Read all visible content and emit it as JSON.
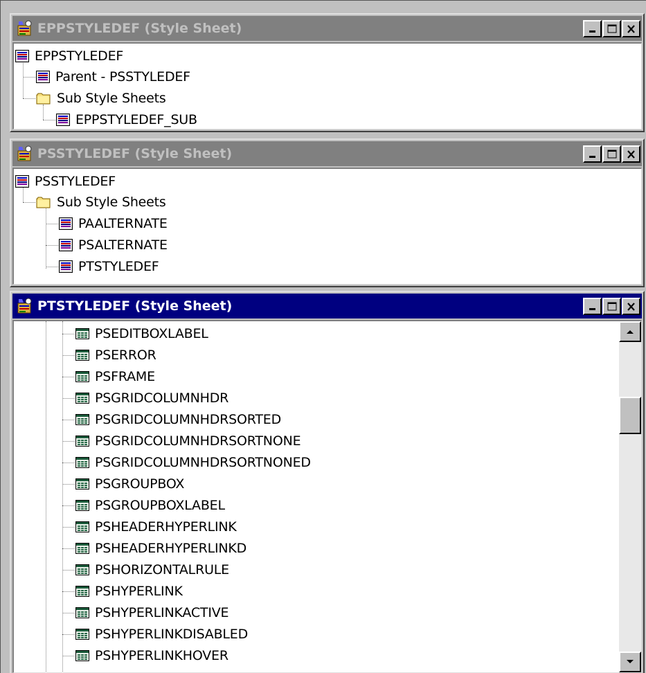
{
  "windows": [
    {
      "title": "EPPSTYLEDEF (Style Sheet)",
      "active": false,
      "tree": [
        {
          "label": "EPPSTYLEDEF",
          "icon": "stylesheet-icon"
        },
        {
          "label": "Parent - PSSTYLEDEF",
          "icon": "stylesheet-icon"
        },
        {
          "label": "Sub Style Sheets",
          "icon": "folder-icon"
        },
        {
          "label": "EPPSTYLEDEF_SUB",
          "icon": "stylesheet-icon"
        }
      ]
    },
    {
      "title": "PSSTYLEDEF (Style Sheet)",
      "active": false,
      "tree": [
        {
          "label": "PSSTYLEDEF",
          "icon": "stylesheet-icon"
        },
        {
          "label": "Sub Style Sheets",
          "icon": "folder-icon"
        },
        {
          "label": "PAALTERNATE",
          "icon": "stylesheet-icon"
        },
        {
          "label": "PSALTERNATE",
          "icon": "stylesheet-icon"
        },
        {
          "label": "PTSTYLEDEF",
          "icon": "stylesheet-icon"
        }
      ]
    },
    {
      "title": "PTSTYLEDEF (Style Sheet)",
      "active": true,
      "tree": [
        {
          "label": "PSEDITBOXLABEL",
          "icon": "style-class-icon"
        },
        {
          "label": "PSERROR",
          "icon": "style-class-icon"
        },
        {
          "label": "PSFRAME",
          "icon": "style-class-icon"
        },
        {
          "label": "PSGRIDCOLUMNHDR",
          "icon": "style-class-icon"
        },
        {
          "label": "PSGRIDCOLUMNHDRSORTED",
          "icon": "style-class-icon"
        },
        {
          "label": "PSGRIDCOLUMNHDRSORTNONE",
          "icon": "style-class-icon"
        },
        {
          "label": "PSGRIDCOLUMNHDRSORTNONED",
          "icon": "style-class-icon"
        },
        {
          "label": "PSGROUPBOX",
          "icon": "style-class-icon"
        },
        {
          "label": "PSGROUPBOXLABEL",
          "icon": "style-class-icon"
        },
        {
          "label": "PSHEADERHYPERLINK",
          "icon": "style-class-icon"
        },
        {
          "label": "PSHEADERHYPERLINKD",
          "icon": "style-class-icon"
        },
        {
          "label": "PSHORIZONTALRULE",
          "icon": "style-class-icon"
        },
        {
          "label": "PSHYPERLINK",
          "icon": "style-class-icon"
        },
        {
          "label": "PSHYPERLINKACTIVE",
          "icon": "style-class-icon"
        },
        {
          "label": "PSHYPERLINKDISABLED",
          "icon": "style-class-icon"
        },
        {
          "label": "PSHYPERLINKHOVER",
          "icon": "style-class-icon"
        }
      ]
    }
  ],
  "controls": {
    "minimize_icon": "minimize-icon",
    "maximize_icon": "maximize-icon",
    "close_icon": "close-icon"
  },
  "scrollbar": {
    "position": 0.2
  },
  "colors": {
    "active_title": "#000080",
    "inactive_title": "#808080",
    "window_face": "#c0c0c0"
  }
}
